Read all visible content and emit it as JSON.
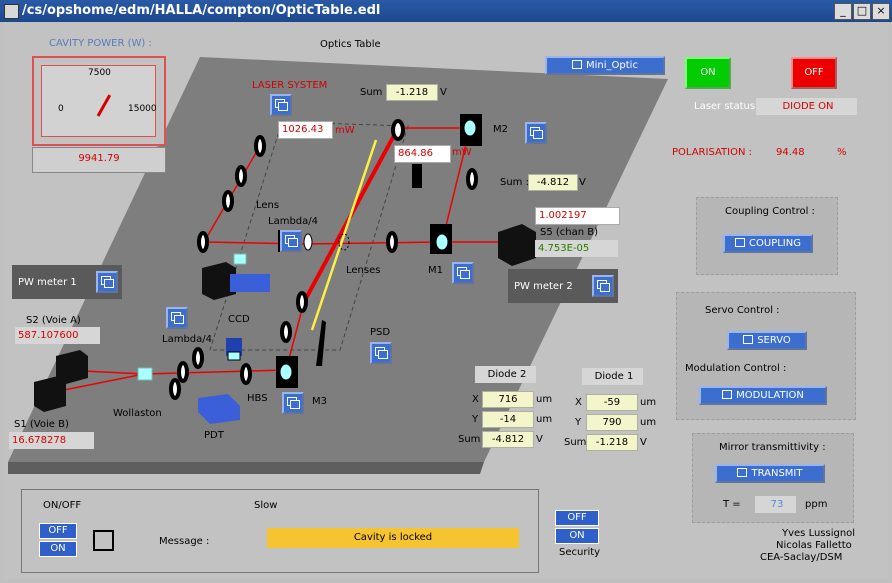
{
  "window": {
    "title": "/cs/opshome/edm/HALLA/compton/OpticTable.edl",
    "minimize": "_",
    "maximize": "□",
    "close": "×"
  },
  "header": {
    "optics_title": "Optics Table",
    "mini_optic_button": "Mini_Optic"
  },
  "cavity": {
    "title": "CAVITY POWER (W) :",
    "scale_mid": "7500",
    "scale_min": "0",
    "scale_max": "15000",
    "value": "9941.79",
    "needle_fraction": 0.663
  },
  "power_controls": {
    "on_label": "ON",
    "off_label": "OFF",
    "status_label": "Laser status:",
    "status_value": "DIODE ON"
  },
  "polarisation": {
    "label": "POLARISATION :",
    "value": "94.48",
    "unit": "%"
  },
  "table": {
    "laser_system": "LASER SYSTEM",
    "laser_power": "1026.43",
    "laser_unit": "mW",
    "power2": "864.86",
    "power2_unit": "mW",
    "sum_label": "Sum",
    "sum_top": "-1.218",
    "sum_top_unit": "V",
    "sum_right_label": "Sum :",
    "sum_right": "-4.812",
    "sum_right_unit": "V",
    "m2": "M2",
    "m1": "M1",
    "m3": "M3",
    "lens": "Lens",
    "lambda4_top": "Lambda/4",
    "lambda4_bottom": "Lambda/4",
    "lenses": "Lenses",
    "ccd": "CCD",
    "psd": "PSD",
    "hbs": "HBS",
    "pdt": "PDT",
    "wollaston": "Wollaston",
    "s5_value": "1.002197",
    "s5_label": "S5 (chan B)",
    "s5_value2": "4.753E-05"
  },
  "pw_meter_1": "PW meter 1",
  "pw_meter_2": "PW meter 2",
  "s2": {
    "label": "S2 (Voie A)",
    "value": "587.107600"
  },
  "s1": {
    "label": "S1 (Voie B)",
    "value": "16.678278"
  },
  "diode2": {
    "title": "Diode 2",
    "x_label": "X",
    "x": "716",
    "y_label": "Y",
    "y": "-14",
    "sum_label": "Sum",
    "sum": "-4.812",
    "unit": "um",
    "sum_unit": "V"
  },
  "diode1": {
    "title": "Diode 1",
    "x_label": "X",
    "x": "-59",
    "y_label": "Y",
    "y": "790",
    "sum_label": "Sum",
    "sum": "-1.218",
    "unit": "um",
    "sum_unit": "V"
  },
  "coupling": {
    "title": "Coupling Control :",
    "button": "COUPLING"
  },
  "servo": {
    "title": "Servo Control :",
    "button": "SERVO"
  },
  "modulation": {
    "title": "Modulation Control :",
    "button": "MODULATION"
  },
  "mirror": {
    "title": "Mirror transmittivity :",
    "button": "TRANSMIT",
    "t_label": "T =",
    "t_value": "73",
    "t_unit": "ppm"
  },
  "bottom": {
    "onoff_title": "ON/OFF",
    "off_label": "OFF",
    "on_label": "ON",
    "slow_label": "Slow",
    "message_label": "Message :",
    "message": "Cavity is locked"
  },
  "security": {
    "off_label": "OFF",
    "on_label": "ON",
    "label": "Security"
  },
  "credits": {
    "line1": "Yves Lussignol",
    "line2": "Nicolas Falletto",
    "line3": "CEA-Saclay/DSM"
  },
  "colors": {
    "on_green": "#00cc00",
    "off_red": "#ee0000",
    "message_bg": "#f5c430",
    "relbtn_blue": "#3c6ed0"
  }
}
